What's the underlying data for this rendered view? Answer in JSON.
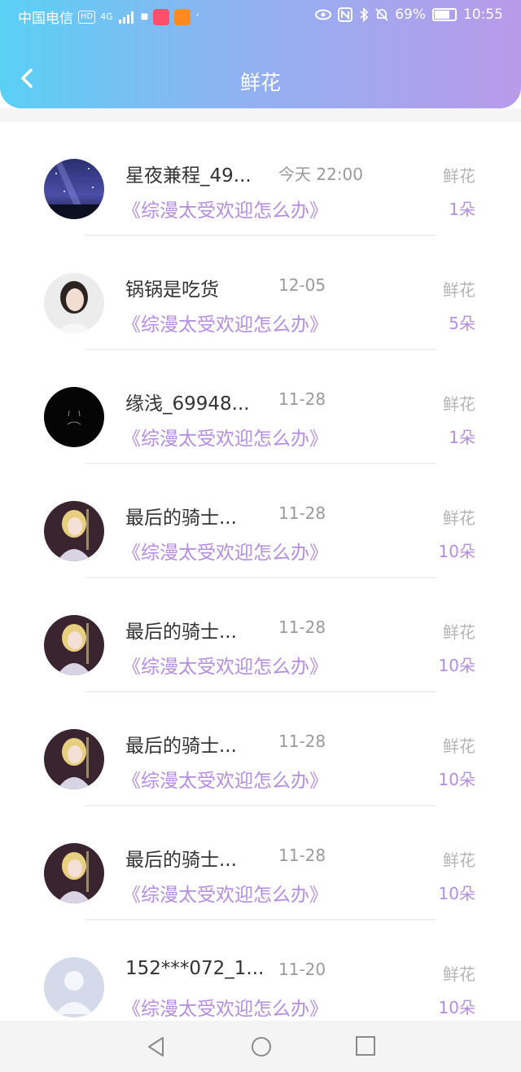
{
  "status_bar": {
    "carrier": "中国电信",
    "hd": "HD",
    "signal": "4G",
    "battery": "69%",
    "time": "10:55"
  },
  "header": {
    "title": "鲜花",
    "back_icon": "back-chevron-icon"
  },
  "items": [
    {
      "name": "星夜兼程_49...",
      "time": "今天 22:00",
      "work": "《综漫太受欢迎怎么办》",
      "label": "鲜花",
      "count": "1朵",
      "avatar": "starry-sky"
    },
    {
      "name": "锅锅是吃货",
      "time": "12-05",
      "work": "《综漫太受欢迎怎么办》",
      "label": "鲜花",
      "count": "5朵",
      "avatar": "girl-photo"
    },
    {
      "name": "缘浅_69948...",
      "time": "11-28",
      "work": "《综漫太受欢迎怎么办》",
      "label": "鲜花",
      "count": "1朵",
      "avatar": "black-face"
    },
    {
      "name": "最后的骑士...",
      "time": "11-28",
      "work": "《综漫太受欢迎怎么办》",
      "label": "鲜花",
      "count": "10朵",
      "avatar": "anime-knight"
    },
    {
      "name": "最后的骑士...",
      "time": "11-28",
      "work": "《综漫太受欢迎怎么办》",
      "label": "鲜花",
      "count": "10朵",
      "avatar": "anime-knight"
    },
    {
      "name": "最后的骑士...",
      "time": "11-28",
      "work": "《综漫太受欢迎怎么办》",
      "label": "鲜花",
      "count": "10朵",
      "avatar": "anime-knight"
    },
    {
      "name": "最后的骑士...",
      "time": "11-28",
      "work": "《综漫太受欢迎怎么办》",
      "label": "鲜花",
      "count": "10朵",
      "avatar": "anime-knight"
    },
    {
      "name": "152***072_1...",
      "time": "11-20",
      "work": "《综漫太受欢迎怎么办》",
      "label": "鲜花",
      "count": "10朵",
      "avatar": "default-user"
    }
  ],
  "colors": {
    "accent": "#b58de3",
    "gradient_start": "#5ad0f5",
    "gradient_end": "#b99ae9"
  }
}
